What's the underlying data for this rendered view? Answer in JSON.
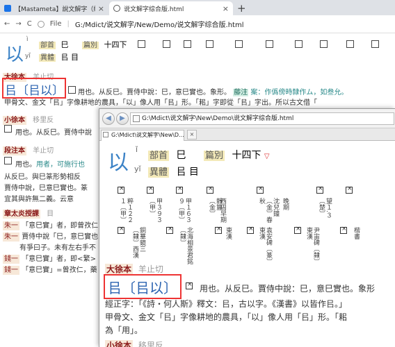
{
  "back": {
    "tabs": [
      {
        "label": "【Mastameta】說文解字（綜合版",
        "close": "×",
        "icon_color": "#1a73e8"
      },
      {
        "label": "说文解字综合版.html",
        "close": "×",
        "icon_color": "#4a4a4a"
      }
    ],
    "new_tab": "+",
    "nav": {
      "back": "←",
      "forward": "→",
      "reload": "C",
      "file_label": "File"
    },
    "url": "G:/Mdict/说文解字/New/Demo/说文解字综合版.html",
    "head_char": "以",
    "head_pron": "yǐ",
    "head_pron_top": "ì",
    "radical_label": "部首",
    "radical_value": "巳",
    "variant_label": "異體",
    "variant_value": "㠯 目",
    "volume_label": "篇別",
    "volume_value": "十四下",
    "sec_daxu": "大徐本",
    "sec_daxu_note": "羊止切",
    "seal_form": "㠯〔㠯以〕",
    "daxu_text": "用也。从反巳。賈侍中說：巳，意巳實也。象形。",
    "badge_text": "藤注",
    "daxu_tail": "案：作僞傍時隸作ム，如叁允。",
    "line2": "甲骨文、金文「㠯」字像耕地的農具，「以」像人用「㠯」形。「耜」字即從「㠯」字出。所以古文借「",
    "sec_xiaoxu": "小徐本",
    "sec_xiaoxu_note": "移里反",
    "xiaoxu_text": "用也。从反巳。賈侍中說",
    "sec_duan": "段注本",
    "sec_duan_note": "羊止切",
    "duan_text_a": "用也。",
    "duan_text_b": "用者，可施行也",
    "duan_lines": [
      "从反巳。與巳篆形勢相反",
      "賈侍中說，巳意巳實也。篆",
      "宜其與許無二義。云意"
    ],
    "sec_zhang": "章太炎授課",
    "zhang_note": "目",
    "zhu_lines": [
      {
        "tag": "朱一",
        "text": "「意巳實」者，即曾孜仁"
      },
      {
        "tag": "朱一",
        "text": "賈侍中說「巳，意巳實也"
      },
      {
        "tag": "",
        "text": "有爭曰子。未有左右手不"
      },
      {
        "tag": "錢一",
        "text": "「意巳實」者，即<繁>"
      },
      {
        "tag": "錢一",
        "text": "「意巳實」=曾孜仁，藥"
      }
    ]
  },
  "front": {
    "nav_back": "◀",
    "nav_forward": "▶",
    "url": "G:\\Mdict\\说文解字\\New\\Demo\\说文解字综合版.html",
    "tab_label": "G:\\Mdict\\说文解字\\New\\D...",
    "tab_close": "×",
    "head_char": "以",
    "head_pron": "yǐ",
    "head_pron_top": "ǐ",
    "radical_label": "部首",
    "radical_value": "巳",
    "variant_label": "異體",
    "variant_value": "㠯 目",
    "volume_label": "篇別",
    "volume_value": "十四下",
    "volume_mark": "▽",
    "row1_cols": [
      "粹１２２１〔甲〕",
      "甲３９３〔甲〕",
      "甲１６３９〔甲〕",
      "靜簋〔金〕",
      "西周早期",
      "沈兒鐘〔金〕春秋",
      "晚期",
      "望１.３〔楚〕"
    ],
    "row2_cols": [
      "銅華鏡三〔隸〕西漢",
      "北海相景君銘〔隸〕",
      "東漢",
      "袁安碑〔篆〕東漢",
      "尹宙碑〔隸〕東漢",
      "楷書"
    ],
    "sec_daxu": "大徐本",
    "sec_daxu_note": "羊止切",
    "seal_form": "㠯〔㠯以〕",
    "daxu_text": "用也。从反巳。賈侍中說：巳，意巳實也。象形",
    "line2": "經正字：「《詩・何人斯》釋文：㠯，古以字。《漢書》以皆作㠯。」",
    "line3": "甲骨文、金文「㠯」字像耕地的農具，「以」像人用「㠯」形。「耜",
    "line4": "為「用」。",
    "sec_xiaoxu": "小徐本",
    "sec_xiaoxu_note": "移里反"
  }
}
